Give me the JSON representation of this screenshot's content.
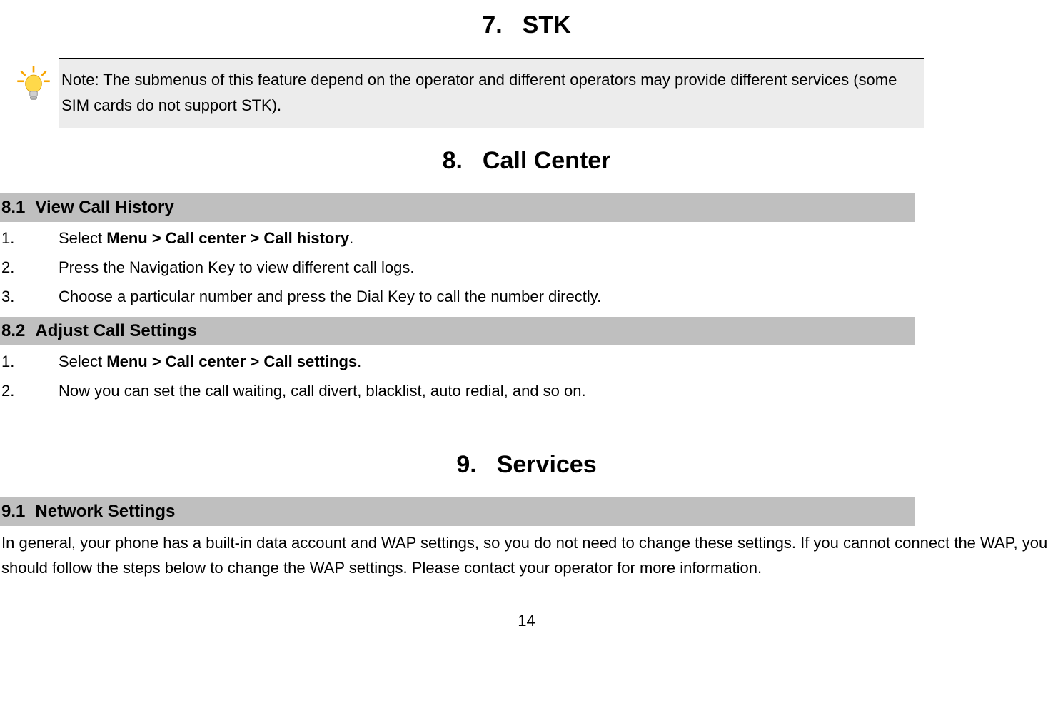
{
  "chapter7": {
    "num": "7.",
    "title": "STK"
  },
  "note": {
    "text": "Note: The submenus of this feature depend on the operator and different operators may provide different services (some SIM cards do not support STK)."
  },
  "chapter8": {
    "num": "8.",
    "title": "Call Center"
  },
  "section81": {
    "num": "8.1",
    "title": "View Call History"
  },
  "steps81": {
    "n1": "1.",
    "t1a": "Select ",
    "t1b": "Menu > Call center > Call history",
    "t1c": ".",
    "n2": "2.",
    "t2": "Press the Navigation Key to view different call logs.",
    "n3": "3.",
    "t3": "Choose a particular number and press the Dial Key to call the number directly."
  },
  "section82": {
    "num": "8.2",
    "title": "Adjust Call Settings"
  },
  "steps82": {
    "n1": "1.",
    "t1a": "Select ",
    "t1b": "Menu > Call center > Call settings",
    "t1c": ".",
    "n2": "2.",
    "t2": "Now you can set the call waiting, call divert, blacklist, auto redial, and so on."
  },
  "chapter9": {
    "num": "9.",
    "title": "Services"
  },
  "section91": {
    "num": "9.1",
    "title": "Network Settings"
  },
  "para91": "In general, your phone has a built-in data account and WAP settings, so you do not need to change these settings. If you cannot connect the WAP, you should follow the steps below to change the WAP settings. Please contact your operator for more information.",
  "pageNumber": "14"
}
